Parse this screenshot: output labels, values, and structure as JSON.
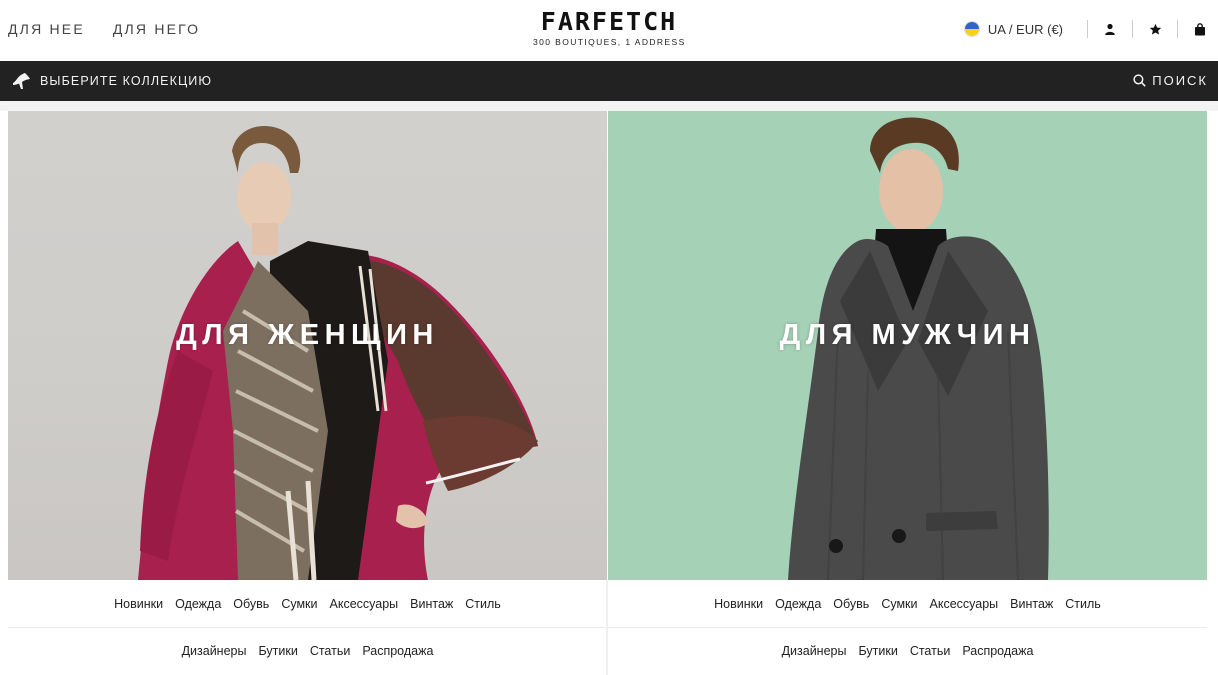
{
  "header": {
    "nav": [
      "ДЛЯ НЕЕ",
      "ДЛЯ НЕГО"
    ],
    "logo": {
      "word": "FARFETCH",
      "tagline": "300 BOUTIQUES, 1 ADDRESS"
    },
    "locale": "UA / EUR (€)",
    "flag_colors": {
      "top": "#2f63c9",
      "bottom": "#f5d21c"
    },
    "icons": [
      "user-icon",
      "star-icon",
      "bag-icon"
    ]
  },
  "bar": {
    "collection_label": "ВЫБЕРИТЕ КОЛЛЕКЦИЮ",
    "collection_icon": "shoe-icon",
    "search_label": "ПОИСК",
    "search_icon": "search-icon",
    "color": "#222222"
  },
  "women": {
    "title": "ДЛЯ ЖЕНЩИН",
    "background": "#d0cecb",
    "row1": [
      "Новинки",
      "Одежда",
      "Обувь",
      "Сумки",
      "Аксессуары",
      "Винтаж",
      "Стиль"
    ],
    "row2": [
      "Дизайнеры",
      "Бутики",
      "Статьи",
      "Распродажа"
    ]
  },
  "men": {
    "title": "ДЛЯ МУЖЧИН",
    "background": "#a5d1b7",
    "row1": [
      "Новинки",
      "Одежда",
      "Обувь",
      "Сумки",
      "Аксессуары",
      "Винтаж",
      "Стиль"
    ],
    "row2": [
      "Дизайнеры",
      "Бутики",
      "Статьи",
      "Распродажа"
    ]
  }
}
